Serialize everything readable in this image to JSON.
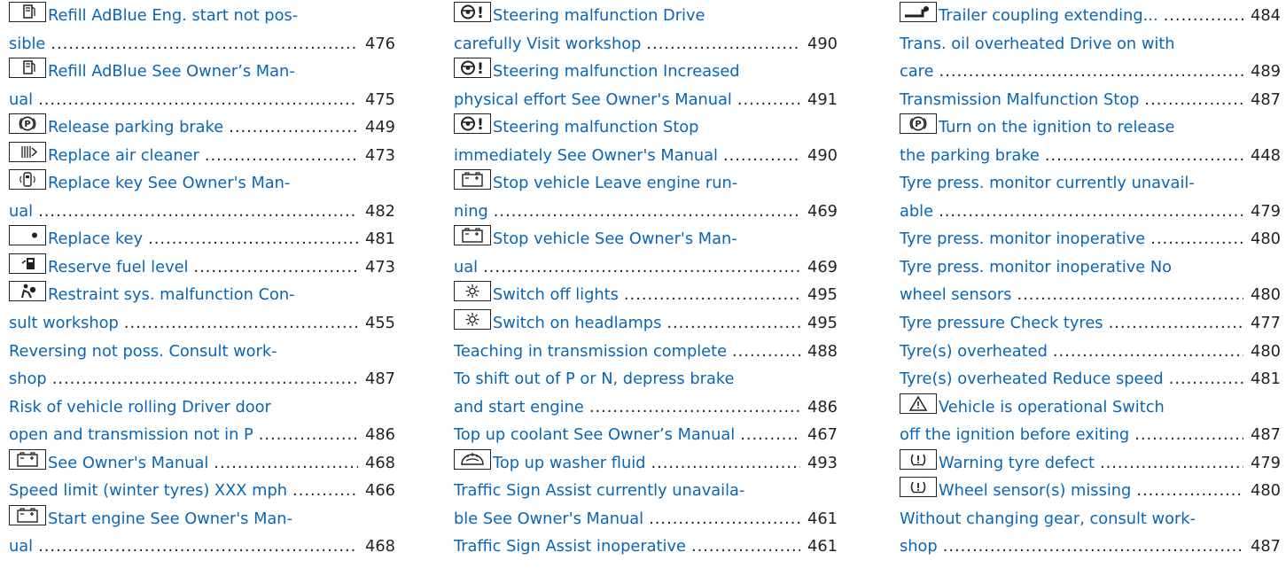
{
  "columns": [
    [
      {
        "icon": "adblue-refill-icon",
        "lines": [
          "Refill AdBlue Eng. start not pos-",
          "sible"
        ],
        "page": "476"
      },
      {
        "icon": "adblue-refill-icon",
        "lines": [
          "Refill AdBlue See Owner’s Man-",
          "ual"
        ],
        "page": "475"
      },
      {
        "icon": "parking-brake-icon",
        "lines": [
          "Release parking brake"
        ],
        "page": "449"
      },
      {
        "icon": "air-cleaner-icon",
        "lines": [
          "Replace air cleaner"
        ],
        "page": "473"
      },
      {
        "icon": "key-battery-icon",
        "lines": [
          "Replace key See Owner's Man-",
          "ual"
        ],
        "page": "482"
      },
      {
        "icon": "key-icon",
        "lines": [
          "Replace key"
        ],
        "page": "481"
      },
      {
        "icon": "fuel-pump-icon",
        "lines": [
          "Reserve fuel level"
        ],
        "page": "473"
      },
      {
        "icon": "airbag-icon",
        "lines": [
          "Restraint sys. malfunction Con-",
          "sult workshop"
        ],
        "page": "455"
      },
      {
        "icon": "",
        "lines": [
          "Reversing not poss. Consult work-",
          "shop"
        ],
        "page": "487"
      },
      {
        "icon": "",
        "lines": [
          "Risk of vehicle rolling Driver door",
          "open and transmission not in P"
        ],
        "page": "486"
      },
      {
        "icon": "battery-icon",
        "lines": [
          "See Owner's Manual"
        ],
        "page": "468"
      },
      {
        "icon": "",
        "lines": [
          "Speed limit (winter tyres) XXX mph"
        ],
        "page": "466"
      },
      {
        "icon": "battery-icon",
        "lines": [
          "Start engine See Owner's Man-",
          "ual"
        ],
        "page": "468"
      }
    ],
    [
      {
        "icon": "steering-warning-icon",
        "lines": [
          "Steering malfunction Drive",
          "carefully Visit workshop"
        ],
        "page": "490"
      },
      {
        "icon": "steering-warning-icon",
        "lines": [
          "Steering malfunction Increased",
          "physical effort See Owner's Manual"
        ],
        "page": "491"
      },
      {
        "icon": "steering-warning-icon",
        "lines": [
          "Steering malfunction Stop",
          "immediately See Owner's Manual"
        ],
        "page": "490"
      },
      {
        "icon": "battery-icon",
        "lines": [
          "Stop vehicle Leave engine run-",
          "ning"
        ],
        "page": "469"
      },
      {
        "icon": "battery-icon",
        "lines": [
          "Stop vehicle See Owner's Man-",
          "ual"
        ],
        "page": "469"
      },
      {
        "icon": "light-icon",
        "lines": [
          "Switch off lights"
        ],
        "page": "495"
      },
      {
        "icon": "light-icon",
        "lines": [
          "Switch on headlamps"
        ],
        "page": "495"
      },
      {
        "icon": "",
        "lines": [
          "Teaching in transmission complete"
        ],
        "page": "488"
      },
      {
        "icon": "",
        "lines": [
          "To shift out of P or N, depress brake",
          "and start engine"
        ],
        "page": "486"
      },
      {
        "icon": "",
        "lines": [
          "Top up coolant See Owner’s Manual"
        ],
        "page": "467"
      },
      {
        "icon": "washer-fluid-icon",
        "lines": [
          "Top up washer fluid"
        ],
        "page": "493"
      },
      {
        "icon": "",
        "lines": [
          "Traffic Sign Assist currently unavaila-",
          "ble See Owner's Manual"
        ],
        "page": "461"
      },
      {
        "icon": "",
        "lines": [
          "Traffic Sign Assist inoperative"
        ],
        "page": "461"
      }
    ],
    [
      {
        "icon": "trailer-coupling-icon",
        "lines": [
          "Trailer coupling extending..."
        ],
        "page": "484"
      },
      {
        "icon": "",
        "lines": [
          "Trans. oil overheated Drive on with",
          "care"
        ],
        "page": "489"
      },
      {
        "icon": "",
        "lines": [
          "Transmission Malfunction Stop"
        ],
        "page": "487"
      },
      {
        "icon": "parking-brake-icon",
        "lines": [
          "Turn on the ignition to release",
          "the parking brake"
        ],
        "page": "448"
      },
      {
        "icon": "",
        "lines": [
          "Tyre press. monitor currently unavail-",
          "able"
        ],
        "page": "479"
      },
      {
        "icon": "",
        "lines": [
          "Tyre press. monitor inoperative"
        ],
        "page": "480"
      },
      {
        "icon": "",
        "lines": [
          "Tyre press. monitor inoperative No",
          "wheel sensors"
        ],
        "page": "480"
      },
      {
        "icon": "",
        "lines": [
          "Tyre pressure Check tyres"
        ],
        "page": "477"
      },
      {
        "icon": "",
        "lines": [
          "Tyre(s) overheated"
        ],
        "page": "480"
      },
      {
        "icon": "",
        "lines": [
          "Tyre(s) overheated Reduce speed"
        ],
        "page": "481"
      },
      {
        "icon": "warning-triangle-icon",
        "lines": [
          "Vehicle is operational Switch",
          "off the ignition before exiting"
        ],
        "page": "487"
      },
      {
        "icon": "tyre-pressure-icon",
        "lines": [
          "Warning tyre defect"
        ],
        "page": "479"
      },
      {
        "icon": "tyre-pressure-icon",
        "lines": [
          "Wheel sensor(s) missing"
        ],
        "page": "480"
      },
      {
        "icon": "",
        "lines": [
          "Without changing gear, consult work-",
          "shop"
        ],
        "page": "487"
      }
    ]
  ]
}
